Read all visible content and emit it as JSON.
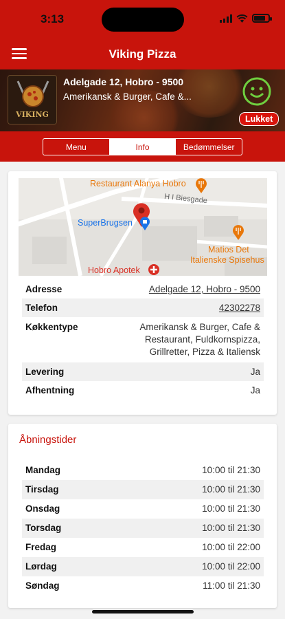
{
  "status_bar": {
    "time": "3:13",
    "battery_level": 0.8
  },
  "header": {
    "title": "Viking Pizza",
    "menu_icon": "hamburger-menu-icon"
  },
  "restaurant": {
    "address_line": "Adelgade 12, Hobro - 9500",
    "cuisine_line": "Amerikansk & Burger, Cafe &...",
    "logo_text": "VIKING",
    "status": "Lukket",
    "smiley_icon": "elite-smiley-icon"
  },
  "tabs": [
    {
      "label": "Menu"
    },
    {
      "label": "Info"
    },
    {
      "label": "Bedømmelser"
    }
  ],
  "map": {
    "labels": {
      "restaurant_alanya": "Restaurant Alanya Hobro",
      "street": "H I Biesgade",
      "superbrugsen": "SuperBrugsen",
      "matios": "Matios Det",
      "matios2": "Italienske Spisehus",
      "apotek": "Hobro Apotek"
    }
  },
  "info": {
    "rows": [
      {
        "label": "Adresse",
        "value": "Adelgade 12, Hobro - 9500"
      },
      {
        "label": "Telefon",
        "value": "42302278"
      },
      {
        "label": "Køkkentype",
        "value_lines": [
          "Amerikansk & Burger, Cafe &",
          "Restaurant, Fuldkornspizza,",
          "Grillretter, Pizza & Italiensk"
        ]
      },
      {
        "label": "Levering",
        "value": "Ja"
      },
      {
        "label": "Afhentning",
        "value": "Ja"
      }
    ]
  },
  "hours": {
    "title": "Åbningstider",
    "days": [
      {
        "day": "Mandag",
        "time": "10:00 til 21:30"
      },
      {
        "day": "Tirsdag",
        "time": "10:00 til 21:30"
      },
      {
        "day": "Onsdag",
        "time": "10:00 til 21:30"
      },
      {
        "day": "Torsdag",
        "time": "10:00 til 21:30"
      },
      {
        "day": "Fredag",
        "time": "10:00 til 22:00"
      },
      {
        "day": "Lørdag",
        "time": "10:00 til 22:00"
      },
      {
        "day": "Søndag",
        "time": "11:00 til 21:30"
      }
    ]
  },
  "colors": {
    "brand_red": "#c8140c",
    "map_orange": "#e8770a",
    "map_blue": "#1a73e8",
    "map_red": "#d93025"
  }
}
